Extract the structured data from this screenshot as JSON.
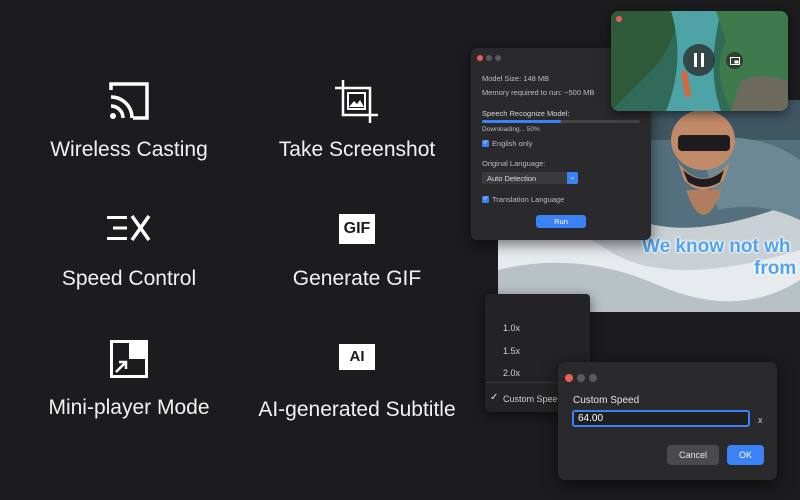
{
  "features": {
    "wireless_casting": "Wireless Casting",
    "take_screenshot": "Take Screenshot",
    "speed_control": "Speed Control",
    "generate_gif": "Generate GIF",
    "mini_player": "Mini-player Mode",
    "ai_subtitle": "AI-generated Subtitle"
  },
  "icons": {
    "gif_badge": "GIF",
    "ai_badge": "AI"
  },
  "ai_panel": {
    "model_size": "Model Size: 148 MB",
    "memory": "Memory required to run: ~500 MB",
    "speech_model_label": "Speech Recognize Model:",
    "progress": 0.5,
    "downloading": "Downloading... 50%",
    "english_only": "English only",
    "original_language_label": "Original Language:",
    "original_language_value": "Auto Detection",
    "translation_language": "Translation Language",
    "run_button": "Run"
  },
  "video": {
    "subtitle_line1": "We know not wh",
    "subtitle_line2": "from"
  },
  "speed_menu": {
    "items": [
      "1.0x",
      "1.5x",
      "2.0x"
    ],
    "custom": "Custom Speed"
  },
  "custom_dialog": {
    "title": "Custom Speed",
    "value": "64.00",
    "unit": "x",
    "cancel": "Cancel",
    "ok": "OK"
  },
  "colors": {
    "accent": "#3b82f6",
    "background": "#1c1c1f",
    "subtitle": "#4fa3f0"
  }
}
